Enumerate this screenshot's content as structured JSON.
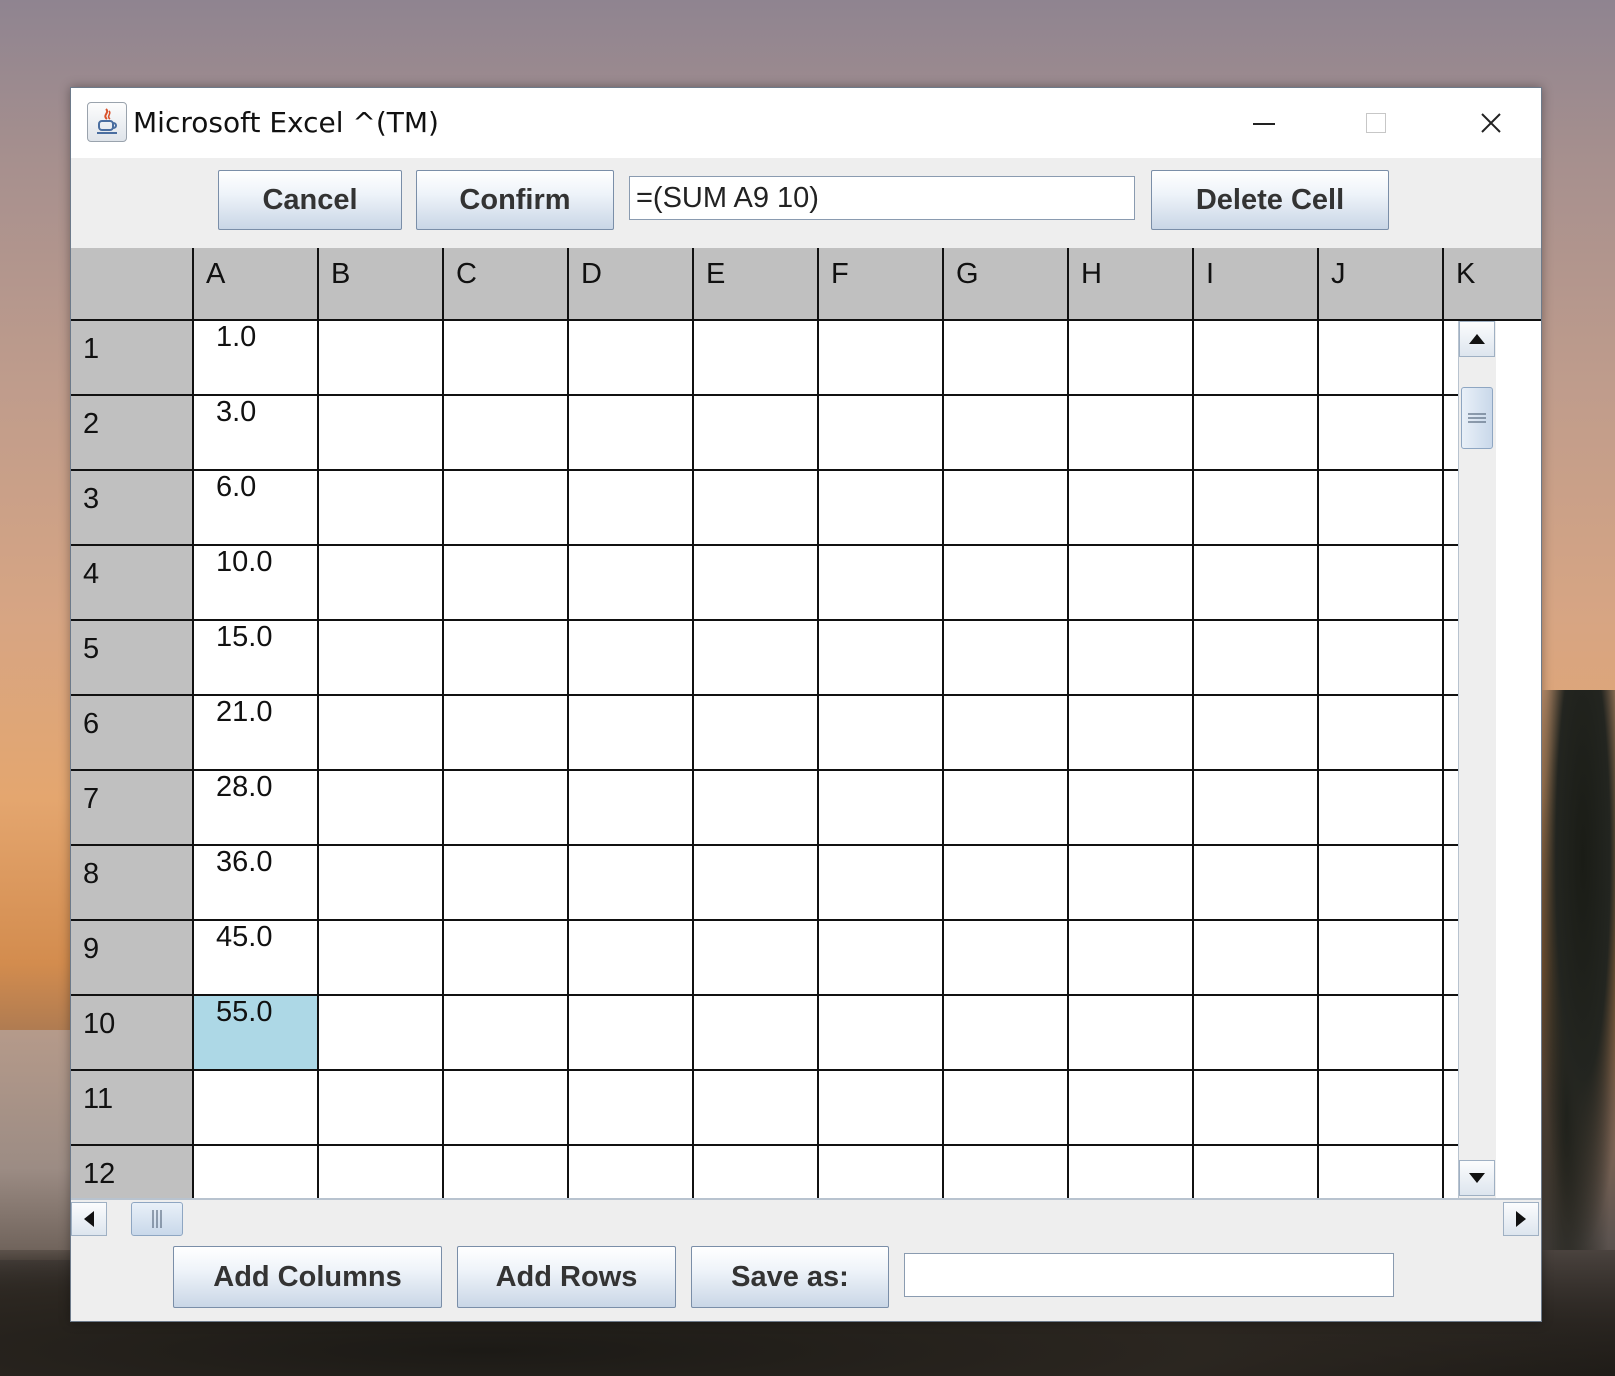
{
  "window": {
    "title": "Microsoft Excel ^(TM)"
  },
  "toolbar": {
    "cancel_label": "Cancel",
    "confirm_label": "Confirm",
    "formula_value": "=(SUM A9 10)",
    "delete_label": "Delete Cell"
  },
  "sheet": {
    "columns": [
      "A",
      "B",
      "C",
      "D",
      "E",
      "F",
      "G",
      "H",
      "I",
      "J",
      "K"
    ],
    "row_numbers": [
      "1",
      "2",
      "3",
      "4",
      "5",
      "6",
      "7",
      "8",
      "9",
      "10",
      "11",
      "12"
    ],
    "column_a_values": [
      "1.0",
      "3.0",
      "6.0",
      "10.0",
      "15.0",
      "21.0",
      "28.0",
      "36.0",
      "45.0",
      "55.0",
      "",
      ""
    ],
    "selected_cell": "A10",
    "selected_color": "#add8e6"
  },
  "bottom": {
    "add_columns_label": "Add Columns",
    "add_rows_label": "Add Rows",
    "save_as_label": "Save as:",
    "save_field_value": ""
  }
}
